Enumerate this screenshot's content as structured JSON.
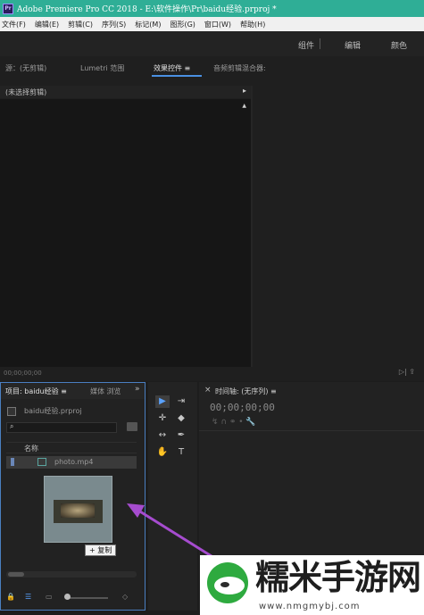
{
  "window": {
    "app_icon": "Pr",
    "title": "Adobe Premiere Pro CC 2018 - E:\\软件操作\\Pr\\baidu经验.prproj *"
  },
  "menu": [
    "文件(F)",
    "编辑(E)",
    "剪辑(C)",
    "序列(S)",
    "标记(M)",
    "图形(G)",
    "窗口(W)",
    "帮助(H)"
  ],
  "workspaces": [
    "组件",
    "编辑",
    "颜色"
  ],
  "top_panel": {
    "tabs": [
      "源：(无剪辑)",
      "Lumetri 范围",
      "效果控件 ≡",
      "音频剪辑混合器:"
    ],
    "active_tab": "效果控件 ≡",
    "header": "(未选择剪辑)",
    "header_arrow": "▸",
    "scroll_up": "▲",
    "timecode": "00;00;00;00",
    "footer_icons": "▷|  ⇪"
  },
  "project_panel": {
    "tab_main": "项目: baidu经验 ≡",
    "tab_media": "媒体 浏览",
    "more": "»",
    "file": "baidu经验.prproj",
    "search_icon": "⌕",
    "column_name": "名称",
    "items": [
      {
        "name": "photo.mp4",
        "type": "video-clip"
      }
    ],
    "drag_tooltip": "+ 复制",
    "footer_icons": [
      "🔒",
      "☰",
      "▭",
      "◇"
    ]
  },
  "tools": [
    "▶",
    "⇥",
    "✛",
    "◆",
    "↔",
    "✒",
    "✋",
    "T"
  ],
  "timeline": {
    "close": "×",
    "title": "时间轴: (无序列) ≡",
    "timecode": "00;00;00;00",
    "tool_icons": "↯  ∩  ⚭  •  🔧"
  },
  "watermark": {
    "title": "糯米手游网",
    "url": "www.nmgmybj.com"
  },
  "colors": {
    "titlebar": "#2fae96",
    "accent": "#4a90e2",
    "arrow": "#a64ccf"
  }
}
